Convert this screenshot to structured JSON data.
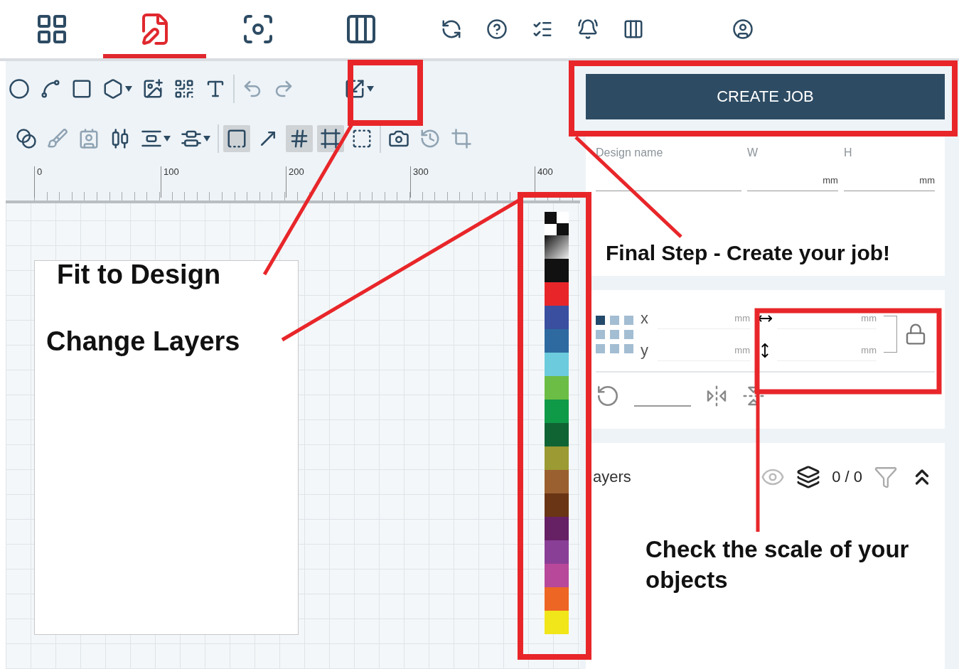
{
  "nav": {
    "tabs": [
      {
        "selected": false
      },
      {
        "selected": true
      },
      {
        "selected": false
      },
      {
        "selected": false
      },
      {
        "selected": false
      },
      {
        "selected": false
      },
      {
        "selected": false
      },
      {
        "selected": false
      },
      {
        "selected": false
      },
      {
        "selected": false
      }
    ]
  },
  "toolbar": {
    "toggles": [
      {
        "on": true
      },
      {
        "on": false
      },
      {
        "on": true
      },
      {
        "on": true
      },
      {
        "on": false
      }
    ]
  },
  "ruler": {
    "labels": [
      "0",
      "100",
      "200",
      "300",
      "400"
    ]
  },
  "palette": [
    {
      "kind": "pattern"
    },
    {
      "kind": "gradient"
    },
    {
      "kind": "swatch",
      "color": "#111111"
    },
    {
      "kind": "swatch",
      "color": "#e8262a"
    },
    {
      "kind": "swatch",
      "color": "#3a4fa0"
    },
    {
      "kind": "swatch",
      "color": "#2e6aa0"
    },
    {
      "kind": "swatch",
      "color": "#6ccbdc"
    },
    {
      "kind": "swatch",
      "color": "#6cbd45"
    },
    {
      "kind": "swatch",
      "color": "#0f9a48"
    },
    {
      "kind": "swatch",
      "color": "#106434"
    },
    {
      "kind": "swatch",
      "color": "#9b9a33"
    },
    {
      "kind": "swatch",
      "color": "#9a6030"
    },
    {
      "kind": "swatch",
      "color": "#6a3515"
    },
    {
      "kind": "swatch",
      "color": "#662064"
    },
    {
      "kind": "swatch",
      "color": "#8a3f96"
    },
    {
      "kind": "swatch",
      "color": "#b7489a"
    },
    {
      "kind": "swatch",
      "color": "#ee6624"
    },
    {
      "kind": "swatch",
      "color": "#f1e619"
    }
  ],
  "job": {
    "create_button": "CREATE JOB",
    "fields": [
      {
        "label": "Design name"
      },
      {
        "label": "W",
        "unit": "mm"
      },
      {
        "label": "H",
        "unit": "mm"
      }
    ]
  },
  "transform": {
    "anchors": [
      {
        "selected": true
      },
      {
        "selected": false
      },
      {
        "selected": false
      },
      {
        "selected": false
      },
      {
        "selected": false
      },
      {
        "selected": false
      },
      {
        "selected": false
      },
      {
        "selected": false
      },
      {
        "selected": false
      }
    ],
    "position": [
      {
        "label": "x",
        "unit": "mm"
      },
      {
        "label": "y",
        "unit": "mm"
      }
    ],
    "size_units": [
      "mm",
      "mm"
    ]
  },
  "layers": {
    "title": "ayers",
    "count": "0 / 0"
  },
  "annotations": [
    {
      "text": "Fit to Design"
    },
    {
      "text": "Change Layers"
    },
    {
      "text": "Final Step - Create your job!"
    },
    {
      "text": "Check the scale of your objects"
    }
  ]
}
